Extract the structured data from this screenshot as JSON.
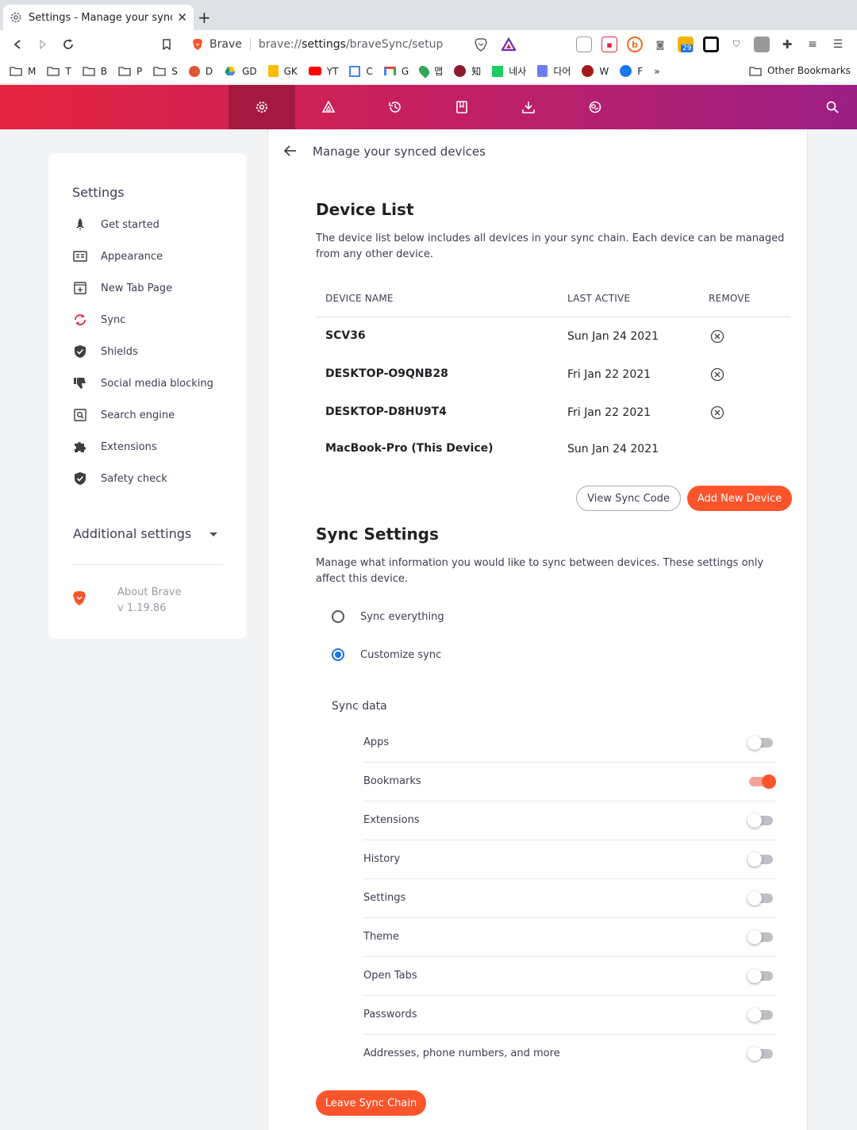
{
  "tab": {
    "title": "Settings - Manage your synced devices"
  },
  "urlbar": {
    "brand": "Brave",
    "url_prefix": "brave://",
    "url_host": "settings",
    "url_path": "/braveSync/setup"
  },
  "bookmarks": [
    {
      "icon": "folder-icon",
      "label": "M"
    },
    {
      "icon": "folder-icon",
      "label": "T"
    },
    {
      "icon": "folder-icon",
      "label": "B"
    },
    {
      "icon": "folder-icon",
      "label": "P"
    },
    {
      "icon": "folder-icon",
      "label": "S"
    },
    {
      "icon": "duckduckgo-icon",
      "label": "D"
    },
    {
      "icon": "google-drive-icon",
      "label": "GD"
    },
    {
      "icon": "keep-icon",
      "label": "GK"
    },
    {
      "icon": "youtube-icon",
      "label": "YT"
    },
    {
      "icon": "calendar-icon",
      "label": "C"
    },
    {
      "icon": "gmail-icon",
      "label": "G"
    },
    {
      "icon": "maps-icon",
      "label": "맵"
    },
    {
      "icon": "university-icon",
      "label": "知"
    },
    {
      "icon": "korean-dict-icon",
      "label": "네사"
    },
    {
      "icon": "dict-icon",
      "label": "다어"
    },
    {
      "icon": "w-icon",
      "label": "W"
    },
    {
      "icon": "facebook-icon",
      "label": "F"
    }
  ],
  "bookmarks_overflow": "»",
  "other_bookmarks": "Other Bookmarks",
  "badge_count": "29",
  "sidebar": {
    "title": "Settings",
    "items": [
      {
        "label": "Get started",
        "icon": "rocket-icon"
      },
      {
        "label": "Appearance",
        "icon": "appearance-icon"
      },
      {
        "label": "New Tab Page",
        "icon": "new-tab-icon"
      },
      {
        "label": "Sync",
        "icon": "sync-icon"
      },
      {
        "label": "Shields",
        "icon": "shield-icon"
      },
      {
        "label": "Social media blocking",
        "icon": "thumbs-down-icon"
      },
      {
        "label": "Search engine",
        "icon": "search-engine-icon"
      },
      {
        "label": "Extensions",
        "icon": "puzzle-icon"
      },
      {
        "label": "Safety check",
        "icon": "safety-check-icon"
      }
    ],
    "additional": "Additional settings",
    "about_title": "About Brave",
    "about_version": "v 1.19.86"
  },
  "page": {
    "subtitle": "Manage your synced devices",
    "device_list_title": "Device List",
    "device_list_desc": "The device list below includes all devices in your sync chain. Each device can be managed from any other device.",
    "columns": [
      "DEVICE NAME",
      "LAST ACTIVE",
      "REMOVE"
    ],
    "devices": [
      {
        "name": "SCV36",
        "last_active": "Sun Jan 24 2021",
        "removable": true
      },
      {
        "name": "DESKTOP-O9QNB28",
        "last_active": "Fri Jan 22 2021",
        "removable": true
      },
      {
        "name": "DESKTOP-D8HU9T4",
        "last_active": "Fri Jan 22 2021",
        "removable": true
      },
      {
        "name": "MacBook-Pro (This Device)",
        "last_active": "Sun Jan 24 2021",
        "removable": false
      }
    ],
    "view_sync_code": "View Sync Code",
    "add_new_device": "Add New Device",
    "sync_settings_title": "Sync Settings",
    "sync_settings_desc": "Manage what information you would like to sync between devices. These settings only affect this device.",
    "radio_sync_everything": "Sync everything",
    "radio_customize": "Customize sync",
    "selected_radio": "customize",
    "sync_data_label": "Sync data",
    "sync_items": [
      {
        "label": "Apps",
        "on": false
      },
      {
        "label": "Bookmarks",
        "on": true
      },
      {
        "label": "Extensions",
        "on": false
      },
      {
        "label": "History",
        "on": false
      },
      {
        "label": "Settings",
        "on": false
      },
      {
        "label": "Theme",
        "on": false
      },
      {
        "label": "Open Tabs",
        "on": false
      },
      {
        "label": "Passwords",
        "on": false
      },
      {
        "label": "Addresses, phone numbers, and more",
        "on": false
      }
    ],
    "leave_sync_chain": "Leave Sync Chain"
  },
  "colors": {
    "accent": "#fb542b",
    "radio_blue": "#1a73e8",
    "nav_start": "#e5243f",
    "nav_end": "#9c1f86"
  }
}
